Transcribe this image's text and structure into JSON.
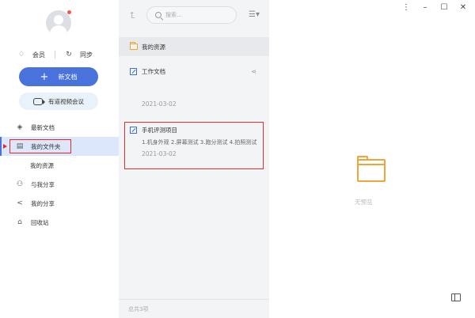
{
  "sidebar": {
    "vip_label": "会员",
    "sync_label": "同步",
    "new_doc_label": "新文档",
    "meeting_label": "有道视频会议",
    "nav": [
      {
        "label": "最新文档",
        "icon": "layers-icon"
      },
      {
        "label": "我的文件夹",
        "icon": "folder-icon",
        "active": true
      },
      {
        "label": "我的资源",
        "icon": ""
      },
      {
        "label": "与我分享",
        "icon": "users-icon"
      },
      {
        "label": "我的分享",
        "icon": "share-icon"
      },
      {
        "label": "回收站",
        "icon": "trash-icon"
      }
    ]
  },
  "list": {
    "search_placeholder": "搜索...",
    "folder_row": "我的资源",
    "items": [
      {
        "title": "工作文档",
        "date": "2021-03-02",
        "desc": ""
      },
      {
        "title": "手机评测项目",
        "desc": "1.机身外观 2.屏幕测试 3.跑分测试 4.拍照测试",
        "date": "2021-03-02"
      }
    ],
    "footer": "总共3项"
  },
  "preview": {
    "empty_text": "无预览"
  },
  "colors": {
    "accent": "#4a72dc",
    "highlight": "#e02b2b",
    "folder": "#f0a43a"
  }
}
